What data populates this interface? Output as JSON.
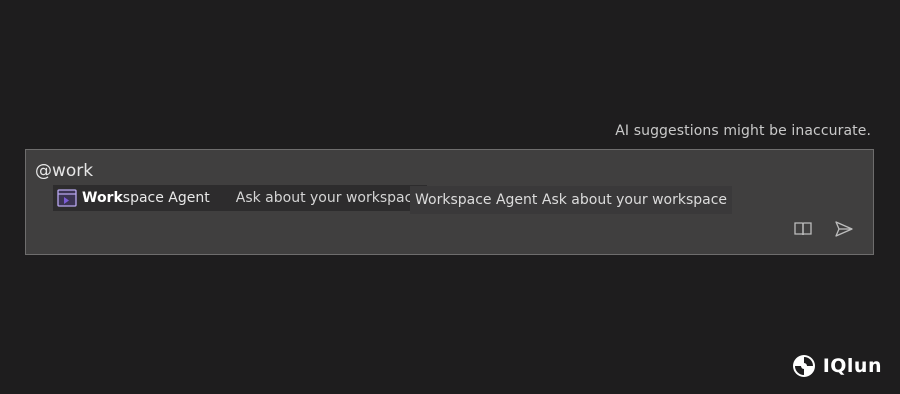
{
  "disclaimer": "AI suggestions might be inaccurate.",
  "input": {
    "value": "@work"
  },
  "suggestion": {
    "icon": "workspace-agent-icon",
    "name_match": "Work",
    "name_rest": "space Agent",
    "description": "Ask about your workspace"
  },
  "tooltip": "Workspace Agent Ask about your workspace",
  "actions": {
    "book_icon": "book-icon",
    "send_icon": "send-icon"
  },
  "watermark": {
    "text": "IQlun",
    "logo": "iqlun-logo"
  },
  "colors": {
    "accent": "#7c5cd6",
    "background": "#1e1d1e",
    "panel": "#403f3f"
  }
}
